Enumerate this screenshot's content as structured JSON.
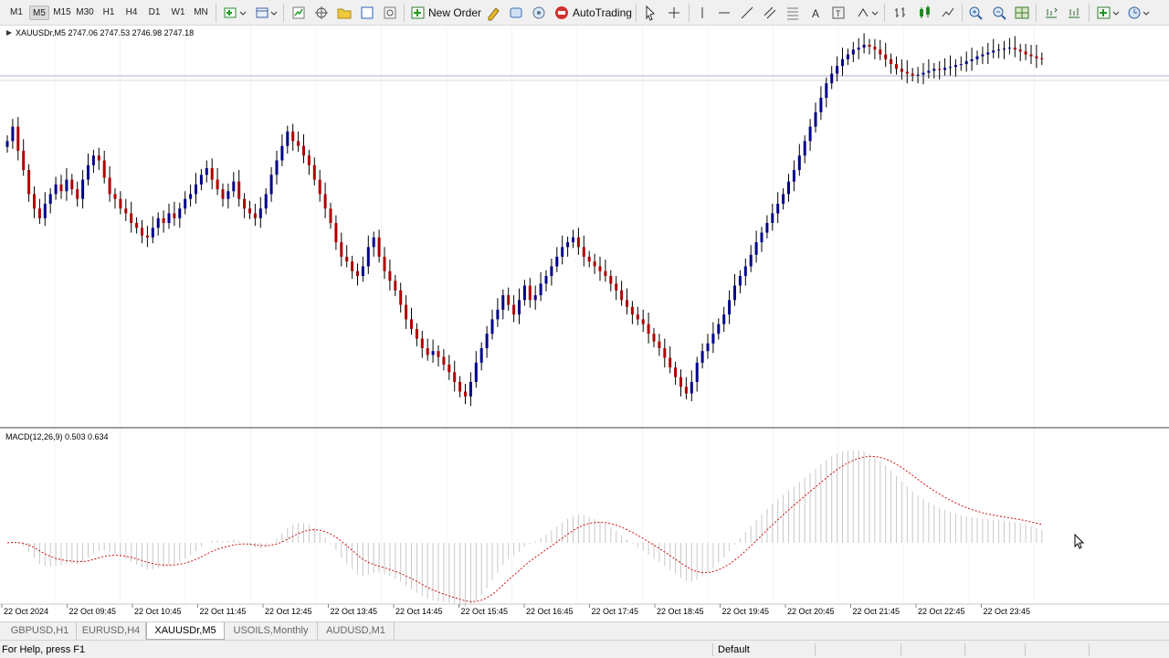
{
  "toolbar": {
    "timeframes": [
      "M1",
      "M5",
      "M15",
      "M30",
      "H1",
      "H4",
      "D1",
      "W1",
      "MN"
    ],
    "active_timeframe": "M5",
    "new_order_label": "New Order",
    "autotrading_label": "AutoTrading"
  },
  "chart": {
    "symbol_info": "XAUUSDr,M5  2747.06 2747.53 2746.98 2747.18",
    "indicator_info": "MACD(12,26,9) 0.503 0.634"
  },
  "tabs": [
    {
      "label": "GBPUSD,H1",
      "active": false
    },
    {
      "label": "EURUSD,H4",
      "active": false
    },
    {
      "label": "XAUUSDr,M5",
      "active": true
    },
    {
      "label": "USOILS,Monthly",
      "active": false
    },
    {
      "label": "AUDUSD,M1",
      "active": false
    }
  ],
  "status": {
    "help_text": "For Help, press F1",
    "profile": "Default"
  },
  "colors": {
    "bull": "#00008b",
    "bear": "#b00000",
    "wick": "#000000",
    "macd_hist": "#c8c8c8",
    "macd_signal": "#d01010",
    "bid_line": "#b0b0c8"
  },
  "chart_data": {
    "type": "candlestick",
    "symbol": "XAUUSDr",
    "timeframe": "M5",
    "x_tick_labels": [
      "22 Oct 2024",
      "22 Oct 09:45",
      "22 Oct 10:45",
      "22 Oct 11:45",
      "22 Oct 12:45",
      "22 Oct 13:45",
      "22 Oct 14:45",
      "22 Oct 15:45",
      "22 Oct 16:45",
      "22 Oct 17:45",
      "22 Oct 18:45",
      "22 Oct 19:45",
      "22 Oct 20:45",
      "22 Oct 21:45",
      "22 Oct 22:45",
      "22 Oct 23:45"
    ],
    "close_series": [
      400,
      415,
      390,
      370,
      345,
      330,
      320,
      335,
      345,
      355,
      348,
      360,
      350,
      340,
      360,
      375,
      385,
      380,
      362,
      345,
      340,
      330,
      325,
      315,
      310,
      302,
      300,
      310,
      320,
      315,
      325,
      320,
      330,
      340,
      345,
      355,
      365,
      372,
      360,
      350,
      340,
      348,
      358,
      340,
      330,
      325,
      320,
      330,
      345,
      365,
      380,
      395,
      410,
      400,
      395,
      385,
      375,
      360,
      345,
      330,
      315,
      295,
      280,
      275,
      265,
      260,
      270,
      290,
      300,
      280,
      265,
      255,
      245,
      230,
      215,
      205,
      195,
      185,
      178,
      182,
      176,
      168,
      160,
      150,
      140,
      135,
      150,
      170,
      185,
      200,
      215,
      225,
      240,
      230,
      220,
      235,
      250,
      235,
      240,
      252,
      260,
      270,
      280,
      290,
      295,
      300,
      290,
      280,
      275,
      270,
      265,
      260,
      252,
      245,
      235,
      228,
      220,
      215,
      210,
      200,
      192,
      185,
      175,
      165,
      155,
      145,
      138,
      150,
      170,
      182,
      190,
      200,
      210,
      220,
      235,
      250,
      260,
      270,
      282,
      295,
      305,
      315,
      325,
      335,
      345,
      358,
      370,
      385,
      400,
      415,
      430,
      445,
      460,
      470,
      478,
      485,
      490,
      495,
      497,
      500,
      498,
      495,
      490,
      485,
      480,
      475,
      472,
      470,
      468,
      469,
      471,
      473,
      475,
      474,
      476,
      477,
      479,
      480,
      483,
      485,
      488,
      490,
      492,
      494,
      495,
      496,
      497,
      495,
      493,
      490,
      488,
      486,
      485
    ]
  }
}
